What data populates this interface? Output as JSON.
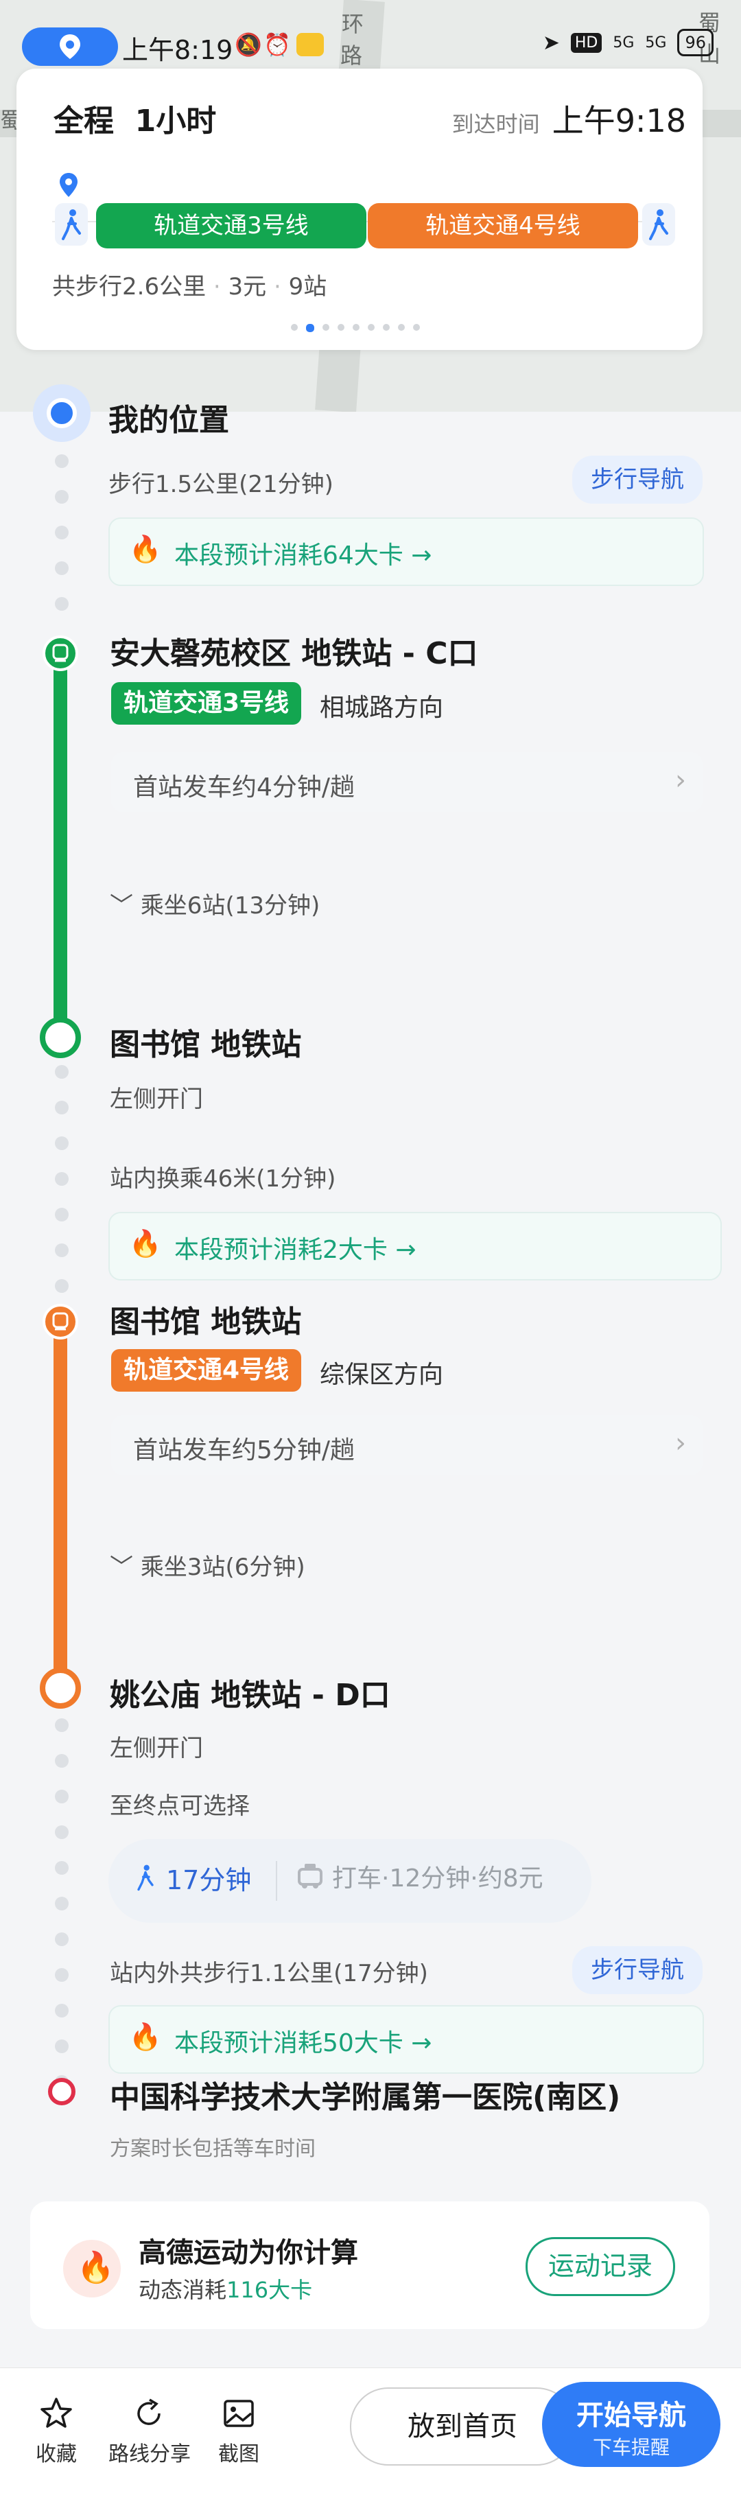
{
  "status_bar": {
    "time": "上午8:19",
    "network": "HD",
    "signal_1": "5G",
    "signal_2": "5G",
    "battery": "96"
  },
  "map": {
    "label_1": "环",
    "label_2": "路",
    "label_3": "蜀山",
    "label_4": "蜀"
  },
  "summary": {
    "total_label": "全程",
    "duration": "1小时",
    "arrive_label": "到达时间",
    "arrive_time": "上午9:18",
    "line_a": "轨道交通3号线",
    "line_b": "轨道交通4号线",
    "walk_total": "共步行2.6公里",
    "price": "3元",
    "stations": "9站",
    "page_dots": 9,
    "active_dot": 1
  },
  "colors": {
    "line3": "#13a650",
    "line4": "#f07a2b",
    "accent": "#2f7cf6",
    "fire": "#f05a3a",
    "green_text": "#19a37a"
  },
  "route": {
    "start": {
      "name": "我的位置",
      "walk": "步行1.5公里(21分钟)",
      "walk_nav": "步行导航",
      "calorie": "本段预计消耗64大卡 →"
    },
    "stop1": {
      "name": "安大磬苑校区 地铁站 - C口",
      "line": "轨道交通3号线",
      "direction": "相城路方向",
      "freq": "首站发车约4分钟/趟",
      "ride": "乘坐6站(13分钟)"
    },
    "stop2": {
      "name": "图书馆 地铁站",
      "door": "左侧开门",
      "transfer": "站内换乘46米(1分钟)",
      "calorie": "本段预计消耗2大卡 →"
    },
    "stop3": {
      "name": "图书馆 地铁站",
      "line": "轨道交通4号线",
      "direction": "综保区方向",
      "freq": "首站发车约5分钟/趟",
      "ride": "乘坐3站(6分钟)"
    },
    "stop4": {
      "name": "姚公庙 地铁站 - D口",
      "door": "左侧开门",
      "choose": "至终点可选择",
      "opt_walk": "17分钟",
      "opt_taxi": "打车·12分钟·约8元",
      "walk": "站内外共步行1.1公里(17分钟)",
      "walk_nav": "步行导航",
      "calorie": "本段预计消耗50大卡 →"
    },
    "end": {
      "name": "中国科学技术大学附属第一医院(南区)",
      "note": "方案时长包括等车时间"
    }
  },
  "sport": {
    "title": "高德运动为你计算",
    "sub_prefix": "动态消耗",
    "sub_value": "116大卡",
    "button": "运动记录"
  },
  "toolbar": {
    "favorite": "收藏",
    "share": "路线分享",
    "screenshot": "截图",
    "home": "放到首页",
    "start": "开始导航",
    "start_sub": "下车提醒"
  }
}
